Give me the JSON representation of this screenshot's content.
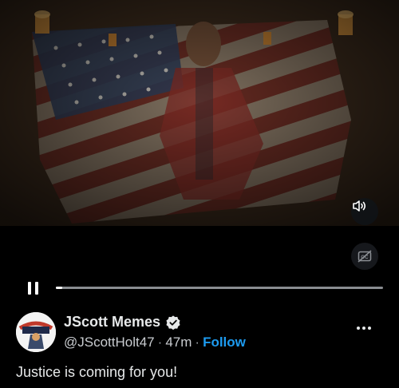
{
  "media": {
    "image_description_icon": "video-frame",
    "volume_icon": "speaker-icon",
    "captions_icon": "captions-off-icon",
    "progress": 0.01
  },
  "author": {
    "display_name": "JScott Memes",
    "verified": true,
    "handle": "@JScottHolt47",
    "separator": "·",
    "time": "47m",
    "follow_label": "Follow",
    "avatar_icon": "avatar-logo"
  },
  "tweet": {
    "text": "Justice is coming for you!"
  },
  "colors": {
    "accent": "#1d9bf0",
    "background": "#000000",
    "text": "#e7e9ea"
  }
}
